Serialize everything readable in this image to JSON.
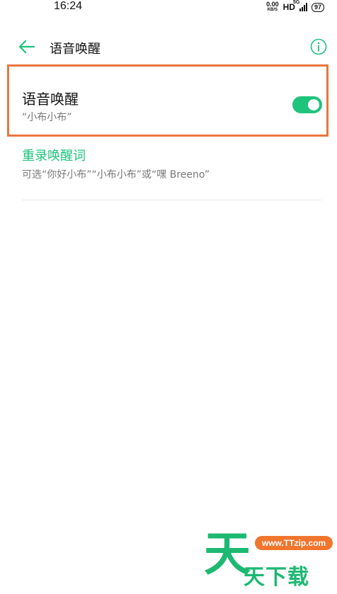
{
  "status_bar": {
    "time": "16:24",
    "net_speed_value": "0.00",
    "net_speed_unit": "KB/S",
    "hd": "HD",
    "network_type": "5G",
    "battery": "97"
  },
  "header": {
    "title": "语音唤醒",
    "back_icon": "arrow-left-icon",
    "info_icon": "info-circle-icon"
  },
  "voice_wake": {
    "title": "语音唤醒",
    "subtitle": "“小布小布”",
    "enabled": true,
    "accent_color": "#1ec37c"
  },
  "rerecord": {
    "label": "重录唤醒词",
    "description": "可选“你好小布”“小布小布”或“嘿 Breeno”"
  },
  "watermark": {
    "big_char": "天",
    "url": "www.TTzip.com",
    "text": "天下载"
  }
}
